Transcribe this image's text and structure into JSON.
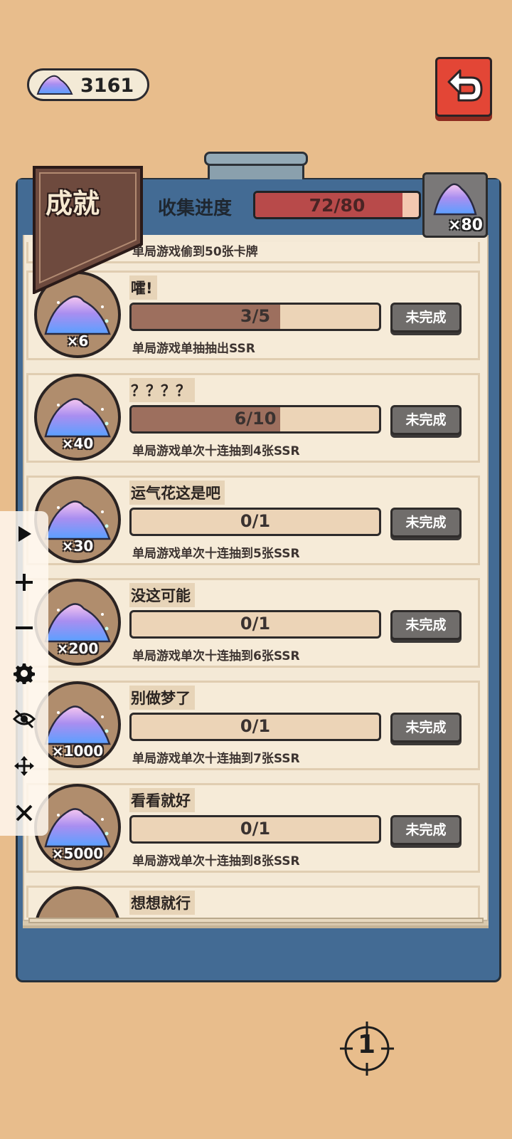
{
  "currency": {
    "icon": "gem-icon",
    "value": "3161"
  },
  "back_button": {
    "icon": "back-arrow-icon"
  },
  "header": {
    "title": "成就",
    "collect_label": "收集进度",
    "collect_progress_text": "72/80",
    "collect_progress_fraction": 0.9,
    "collect_reward": "×80"
  },
  "partial_top_desc": "单局游戏偷到50张卡牌",
  "achievements": [
    {
      "title": "嚯!",
      "progress_text": "3/5",
      "progress_fraction": 0.6,
      "reward": "×6",
      "status": "未完成",
      "desc": "单局游戏单抽抽出SSR"
    },
    {
      "title": "？？？？",
      "progress_text": "6/10",
      "progress_fraction": 0.6,
      "reward": "×40",
      "status": "未完成",
      "desc": "单局游戏单次十连抽到4张SSR"
    },
    {
      "title": "运气花这是吧",
      "progress_text": "0/1",
      "progress_fraction": 0,
      "reward": "×30",
      "status": "未完成",
      "desc": "单局游戏单次十连抽到5张SSR"
    },
    {
      "title": "没这可能",
      "progress_text": "0/1",
      "progress_fraction": 0,
      "reward": "×200",
      "status": "未完成",
      "desc": "单局游戏单次十连抽到6张SSR"
    },
    {
      "title": "别做梦了",
      "progress_text": "0/1",
      "progress_fraction": 0,
      "reward": "×1000",
      "status": "未完成",
      "desc": "单局游戏单次十连抽到7张SSR"
    },
    {
      "title": "看看就好",
      "progress_text": "0/1",
      "progress_fraction": 0,
      "reward": "×5000",
      "status": "未完成",
      "desc": "单局游戏单次十连抽到8张SSR"
    }
  ],
  "partial_bottom_title": "想想就行",
  "toolbar": [
    "play-icon",
    "zoom-in-icon",
    "zoom-out-icon",
    "settings-icon",
    "hide-icon",
    "move-icon",
    "close-icon"
  ],
  "crosshair_number": "1",
  "colors": {
    "board": "#436b94",
    "paper": "#f4e9d6",
    "bar_fill": "#9d6f5e",
    "collect_fill": "#b84a4a",
    "back_button": "#e34636"
  }
}
